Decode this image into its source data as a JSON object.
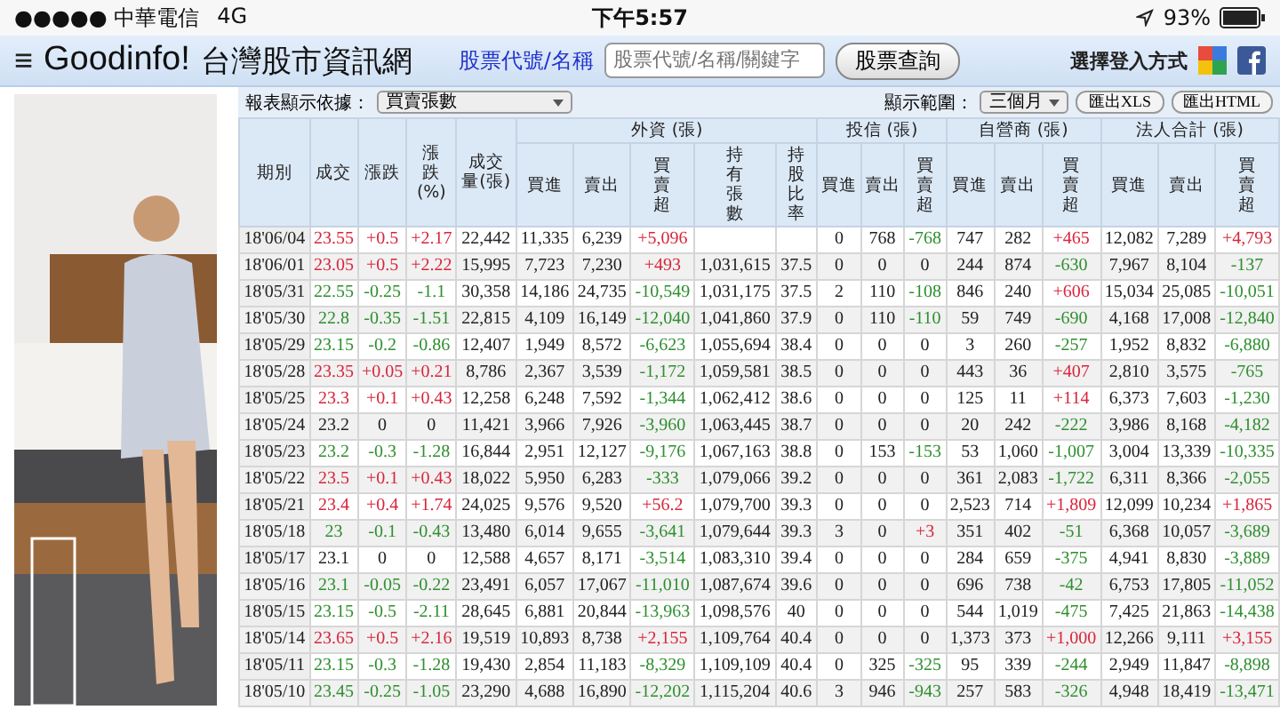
{
  "status_bar": {
    "carrier": "●●●●● 中華電信",
    "network": "4G",
    "time": "下午5:57",
    "battery": "93%"
  },
  "nav": {
    "menu": "≡",
    "brand": "Goodinfo!",
    "site_name": "台灣股市資訊網",
    "search_label": "股票代號/名稱",
    "search": {
      "placeholder": "股票代號/名稱/關鍵字"
    },
    "search_button": "股票查詢",
    "login_label": "選擇登入方式"
  },
  "toolbar": {
    "basis_label": "報表顯示依據：",
    "basis_value": "買賣張數",
    "range_label": "顯示範圍：",
    "range_value": "三個月",
    "buttons": [
      "匯出XLS",
      "匯出HTML"
    ]
  },
  "table": {
    "columns": [
      "期別",
      "成交",
      "漲跌",
      "漲跌(%)",
      "成交量(張)"
    ],
    "groups": [
      {
        "label": "外資 (張)",
        "columns": [
          "買進",
          "賣出",
          "買賣超",
          "持有張數",
          "持股比率"
        ]
      },
      {
        "label": "投信 (張)",
        "columns": [
          "買進",
          "賣出",
          "買賣超"
        ]
      },
      {
        "label": "自營商 (張)",
        "columns": [
          "買進",
          "賣出",
          "買賣超"
        ]
      },
      {
        "label": "法人合計 (張)",
        "columns": [
          "買進",
          "賣出",
          "買賣超"
        ]
      }
    ],
    "rows": [
      {
        "date": "18'06/04",
        "close": "23.55",
        "change": "+0.5",
        "pct": "+2.17",
        "volume": "22,442",
        "color": "#d8263c",
        "groups": [
          {
            "buy": "11,335",
            "sell": "6,239",
            "net": "+5,096",
            "color": "#d8263c"
          },
          {
            "buy": "0",
            "sell": "768",
            "net": "-768",
            "color": "#2f8f2f"
          },
          {
            "buy": "747",
            "sell": "282",
            "net": "+465",
            "color": "#d8263c"
          },
          {
            "buy": "12,082",
            "sell": "7,289",
            "net": "+4,793",
            "color": "#d8263c"
          }
        ]
      },
      {
        "date": "18'06/01",
        "close": "23.05",
        "change": "+0.5",
        "pct": "+2.22",
        "volume": "15,995",
        "color": "#d8263c",
        "groups": [
          {
            "buy": "7,723",
            "sell": "7,230",
            "net": "+493",
            "color": "#d8263c",
            "holding": "1,031,615",
            "ratio": "37.5"
          },
          {
            "buy": "0",
            "sell": "0",
            "net": "0",
            "color": "#222222"
          },
          {
            "buy": "244",
            "sell": "874",
            "net": "-630",
            "color": "#2f8f2f"
          },
          {
            "buy": "7,967",
            "sell": "8,104",
            "net": "-137",
            "color": "#2f8f2f"
          }
        ]
      },
      {
        "date": "18'05/31",
        "close": "22.55",
        "change": "-0.25",
        "pct": "-1.1",
        "volume": "30,358",
        "color": "#2f8f2f",
        "groups": [
          {
            "buy": "14,186",
            "sell": "24,735",
            "net": "-10,549",
            "color": "#2f8f2f",
            "holding": "1,031,175",
            "ratio": "37.5"
          },
          {
            "buy": "2",
            "sell": "110",
            "net": "-108",
            "color": "#2f8f2f"
          },
          {
            "buy": "846",
            "sell": "240",
            "net": "+606",
            "color": "#d8263c"
          },
          {
            "buy": "15,034",
            "sell": "25,085",
            "net": "-10,051",
            "color": "#2f8f2f"
          }
        ]
      },
      {
        "date": "18'05/30",
        "close": "22.8",
        "change": "-0.35",
        "pct": "-1.51",
        "volume": "22,815",
        "color": "#2f8f2f",
        "groups": [
          {
            "buy": "4,109",
            "sell": "16,149",
            "net": "-12,040",
            "color": "#2f8f2f",
            "holding": "1,041,860",
            "ratio": "37.9"
          },
          {
            "buy": "0",
            "sell": "110",
            "net": "-110",
            "color": "#2f8f2f"
          },
          {
            "buy": "59",
            "sell": "749",
            "net": "-690",
            "color": "#2f8f2f"
          },
          {
            "buy": "4,168",
            "sell": "17,008",
            "net": "-12,840",
            "color": "#2f8f2f"
          }
        ]
      },
      {
        "date": "18'05/29",
        "close": "23.15",
        "change": "-0.2",
        "pct": "-0.86",
        "volume": "12,407",
        "color": "#2f8f2f",
        "groups": [
          {
            "buy": "1,949",
            "sell": "8,572",
            "net": "-6,623",
            "color": "#2f8f2f",
            "holding": "1,055,694",
            "ratio": "38.4"
          },
          {
            "buy": "0",
            "sell": "0",
            "net": "0",
            "color": "#222222"
          },
          {
            "buy": "3",
            "sell": "260",
            "net": "-257",
            "color": "#2f8f2f"
          },
          {
            "buy": "1,952",
            "sell": "8,832",
            "net": "-6,880",
            "color": "#2f8f2f"
          }
        ]
      },
      {
        "date": "18'05/28",
        "close": "23.35",
        "change": "+0.05",
        "pct": "+0.21",
        "volume": "8,786",
        "color": "#d8263c",
        "groups": [
          {
            "buy": "2,367",
            "sell": "3,539",
            "net": "-1,172",
            "color": "#2f8f2f",
            "holding": "1,059,581",
            "ratio": "38.5"
          },
          {
            "buy": "0",
            "sell": "0",
            "net": "0",
            "color": "#222222"
          },
          {
            "buy": "443",
            "sell": "36",
            "net": "+407",
            "color": "#d8263c"
          },
          {
            "buy": "2,810",
            "sell": "3,575",
            "net": "-765",
            "color": "#2f8f2f"
          }
        ]
      },
      {
        "date": "18'05/25",
        "close": "23.3",
        "change": "+0.1",
        "pct": "+0.43",
        "volume": "12,258",
        "color": "#d8263c",
        "groups": [
          {
            "buy": "6,248",
            "sell": "7,592",
            "net": "-1,344",
            "color": "#2f8f2f",
            "holding": "1,062,412",
            "ratio": "38.6"
          },
          {
            "buy": "0",
            "sell": "0",
            "net": "0",
            "color": "#222222"
          },
          {
            "buy": "125",
            "sell": "11",
            "net": "+114",
            "color": "#d8263c"
          },
          {
            "buy": "6,373",
            "sell": "7,603",
            "net": "-1,230",
            "color": "#2f8f2f"
          }
        ]
      },
      {
        "date": "18'05/24",
        "close": "23.2",
        "change": "0",
        "pct": "0",
        "volume": "11,421",
        "color": "#222222",
        "groups": [
          {
            "buy": "3,966",
            "sell": "7,926",
            "net": "-3,960",
            "color": "#2f8f2f",
            "holding": "1,063,445",
            "ratio": "38.7"
          },
          {
            "buy": "0",
            "sell": "0",
            "net": "0",
            "color": "#222222"
          },
          {
            "buy": "20",
            "sell": "242",
            "net": "-222",
            "color": "#2f8f2f"
          },
          {
            "buy": "3,986",
            "sell": "8,168",
            "net": "-4,182",
            "color": "#2f8f2f"
          }
        ]
      },
      {
        "date": "18'05/23",
        "close": "23.2",
        "change": "-0.3",
        "pct": "-1.28",
        "volume": "16,844",
        "color": "#2f8f2f",
        "groups": [
          {
            "buy": "2,951",
            "sell": "12,127",
            "net": "-9,176",
            "color": "#2f8f2f",
            "holding": "1,067,163",
            "ratio": "38.8"
          },
          {
            "buy": "0",
            "sell": "153",
            "net": "-153",
            "color": "#2f8f2f"
          },
          {
            "buy": "53",
            "sell": "1,060",
            "net": "-1,007",
            "color": "#2f8f2f"
          },
          {
            "buy": "3,004",
            "sell": "13,339",
            "net": "-10,335",
            "color": "#2f8f2f"
          }
        ]
      },
      {
        "date": "18'05/22",
        "close": "23.5",
        "change": "+0.1",
        "pct": "+0.43",
        "volume": "18,022",
        "color": "#d8263c",
        "groups": [
          {
            "buy": "5,950",
            "sell": "6,283",
            "net": "-333",
            "color": "#2f8f2f",
            "holding": "1,079,066",
            "ratio": "39.2"
          },
          {
            "buy": "0",
            "sell": "0",
            "net": "0",
            "color": "#222222"
          },
          {
            "buy": "361",
            "sell": "2,083",
            "net": "-1,722",
            "color": "#2f8f2f"
          },
          {
            "buy": "6,311",
            "sell": "8,366",
            "net": "-2,055",
            "color": "#2f8f2f"
          }
        ]
      },
      {
        "date": "18'05/21",
        "close": "23.4",
        "change": "+0.4",
        "pct": "+1.74",
        "volume": "24,025",
        "color": "#d8263c",
        "groups": [
          {
            "buy": "9,576",
            "sell": "9,520",
            "net": "+56.2",
            "color": "#d8263c",
            "holding": "1,079,700",
            "ratio": "39.3"
          },
          {
            "buy": "0",
            "sell": "0",
            "net": "0",
            "color": "#222222"
          },
          {
            "buy": "2,523",
            "sell": "714",
            "net": "+1,809",
            "color": "#d8263c"
          },
          {
            "buy": "12,099",
            "sell": "10,234",
            "net": "+1,865",
            "color": "#d8263c"
          }
        ]
      },
      {
        "date": "18'05/18",
        "close": "23",
        "change": "-0.1",
        "pct": "-0.43",
        "volume": "13,480",
        "color": "#2f8f2f",
        "groups": [
          {
            "buy": "6,014",
            "sell": "9,655",
            "net": "-3,641",
            "color": "#2f8f2f",
            "holding": "1,079,644",
            "ratio": "39.3"
          },
          {
            "buy": "3",
            "sell": "0",
            "net": "+3",
            "color": "#d8263c"
          },
          {
            "buy": "351",
            "sell": "402",
            "net": "-51",
            "color": "#2f8f2f"
          },
          {
            "buy": "6,368",
            "sell": "10,057",
            "net": "-3,689",
            "color": "#2f8f2f"
          }
        ]
      },
      {
        "date": "18'05/17",
        "close": "23.1",
        "change": "0",
        "pct": "0",
        "volume": "12,588",
        "color": "#222222",
        "groups": [
          {
            "buy": "4,657",
            "sell": "8,171",
            "net": "-3,514",
            "color": "#2f8f2f",
            "holding": "1,083,310",
            "ratio": "39.4"
          },
          {
            "buy": "0",
            "sell": "0",
            "net": "0",
            "color": "#222222"
          },
          {
            "buy": "284",
            "sell": "659",
            "net": "-375",
            "color": "#2f8f2f"
          },
          {
            "buy": "4,941",
            "sell": "8,830",
            "net": "-3,889",
            "color": "#2f8f2f"
          }
        ]
      },
      {
        "date": "18'05/16",
        "close": "23.1",
        "change": "-0.05",
        "pct": "-0.22",
        "volume": "23,491",
        "color": "#2f8f2f",
        "groups": [
          {
            "buy": "6,057",
            "sell": "17,067",
            "net": "-11,010",
            "color": "#2f8f2f",
            "holding": "1,087,674",
            "ratio": "39.6"
          },
          {
            "buy": "0",
            "sell": "0",
            "net": "0",
            "color": "#222222"
          },
          {
            "buy": "696",
            "sell": "738",
            "net": "-42",
            "color": "#2f8f2f"
          },
          {
            "buy": "6,753",
            "sell": "17,805",
            "net": "-11,052",
            "color": "#2f8f2f"
          }
        ]
      },
      {
        "date": "18'05/15",
        "close": "23.15",
        "change": "-0.5",
        "pct": "-2.11",
        "volume": "28,645",
        "color": "#2f8f2f",
        "groups": [
          {
            "buy": "6,881",
            "sell": "20,844",
            "net": "-13,963",
            "color": "#2f8f2f",
            "holding": "1,098,576",
            "ratio": "40"
          },
          {
            "buy": "0",
            "sell": "0",
            "net": "0",
            "color": "#222222"
          },
          {
            "buy": "544",
            "sell": "1,019",
            "net": "-475",
            "color": "#2f8f2f"
          },
          {
            "buy": "7,425",
            "sell": "21,863",
            "net": "-14,438",
            "color": "#2f8f2f"
          }
        ]
      },
      {
        "date": "18'05/14",
        "close": "23.65",
        "change": "+0.5",
        "pct": "+2.16",
        "volume": "19,519",
        "color": "#d8263c",
        "groups": [
          {
            "buy": "10,893",
            "sell": "8,738",
            "net": "+2,155",
            "color": "#d8263c",
            "holding": "1,109,764",
            "ratio": "40.4"
          },
          {
            "buy": "0",
            "sell": "0",
            "net": "0",
            "color": "#222222"
          },
          {
            "buy": "1,373",
            "sell": "373",
            "net": "+1,000",
            "color": "#d8263c"
          },
          {
            "buy": "12,266",
            "sell": "9,111",
            "net": "+3,155",
            "color": "#d8263c"
          }
        ]
      },
      {
        "date": "18'05/11",
        "close": "23.15",
        "change": "-0.3",
        "pct": "-1.28",
        "volume": "19,430",
        "color": "#2f8f2f",
        "groups": [
          {
            "buy": "2,854",
            "sell": "11,183",
            "net": "-8,329",
            "color": "#2f8f2f",
            "holding": "1,109,109",
            "ratio": "40.4"
          },
          {
            "buy": "0",
            "sell": "325",
            "net": "-325",
            "color": "#2f8f2f"
          },
          {
            "buy": "95",
            "sell": "339",
            "net": "-244",
            "color": "#2f8f2f"
          },
          {
            "buy": "2,949",
            "sell": "11,847",
            "net": "-8,898",
            "color": "#2f8f2f"
          }
        ]
      },
      {
        "date": "18'05/10",
        "close": "23.45",
        "change": "-0.25",
        "pct": "-1.05",
        "volume": "23,290",
        "color": "#2f8f2f",
        "groups": [
          {
            "buy": "4,688",
            "sell": "16,890",
            "net": "-12,202",
            "color": "#2f8f2f",
            "holding": "1,115,204",
            "ratio": "40.6"
          },
          {
            "buy": "3",
            "sell": "946",
            "net": "-943",
            "color": "#2f8f2f"
          },
          {
            "buy": "257",
            "sell": "583",
            "net": "-326",
            "color": "#2f8f2f"
          },
          {
            "buy": "4,948",
            "sell": "18,419",
            "net": "-13,471",
            "color": "#2f8f2f"
          }
        ]
      }
    ]
  }
}
